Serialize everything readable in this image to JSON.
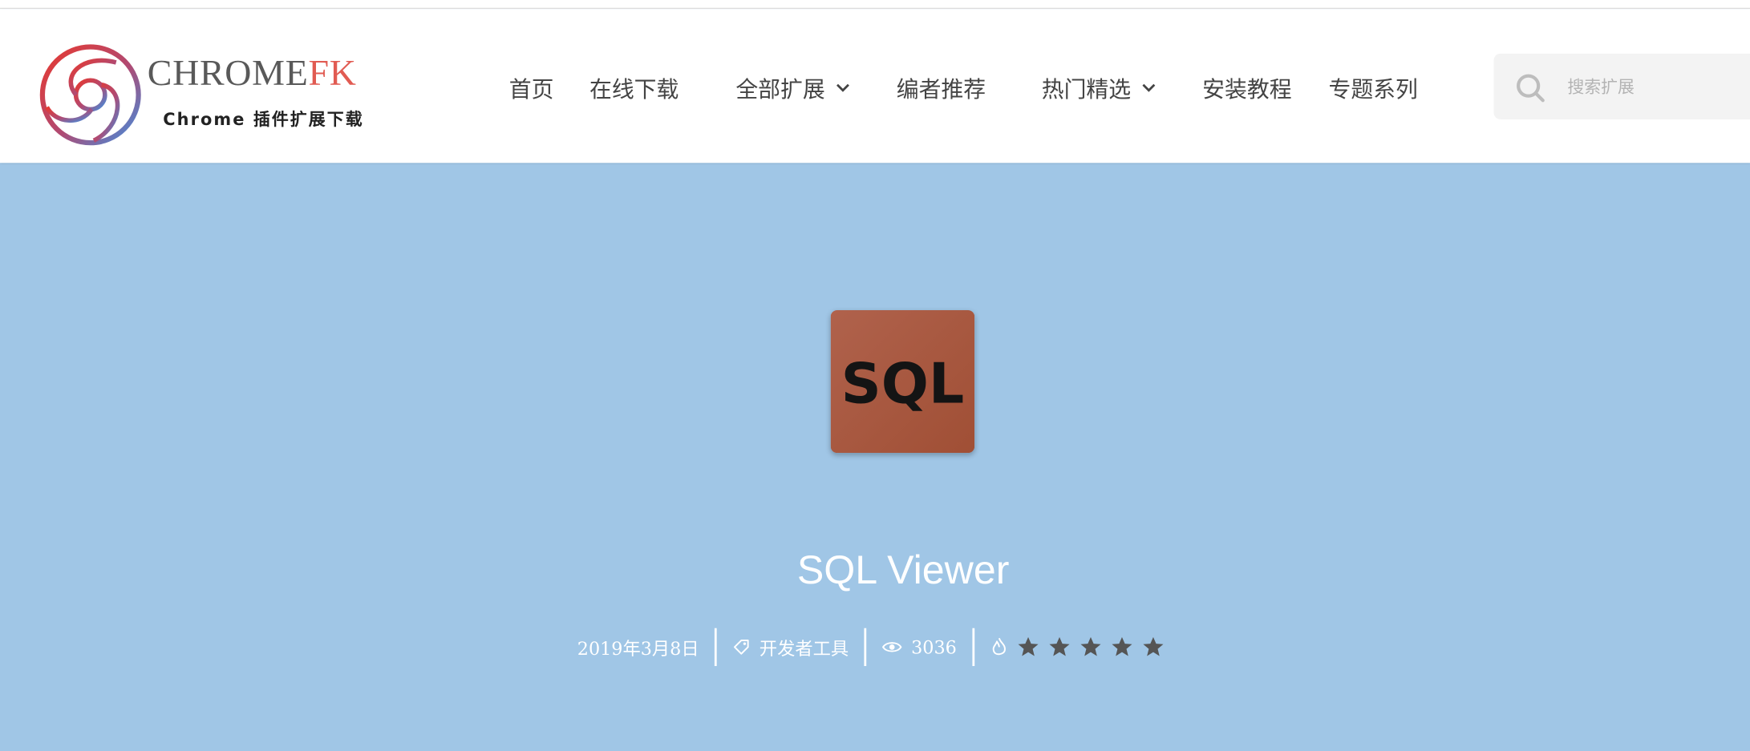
{
  "brand": {
    "word_main": "CHROME",
    "word_accent": "FK",
    "tagline": "Chrome 插件扩展下载"
  },
  "nav": {
    "items": [
      {
        "label": "首页"
      },
      {
        "label": "在线下载"
      },
      {
        "label": "全部扩展"
      },
      {
        "label": "编者推荐"
      },
      {
        "label": "热门精选"
      },
      {
        "label": "安装教程"
      },
      {
        "label": "专题系列"
      }
    ]
  },
  "search": {
    "placeholder": "搜索扩展",
    "value": ""
  },
  "extension": {
    "icon_text": "SQL",
    "title": "SQL Viewer",
    "date": "2019年3月8日",
    "category": "开发者工具",
    "views": "3036",
    "rating": 5
  },
  "colors": {
    "hero_bg": "#a0c6e6",
    "accent": "#e15b52",
    "icon_bg": "#a9553b",
    "star": "#555555"
  }
}
